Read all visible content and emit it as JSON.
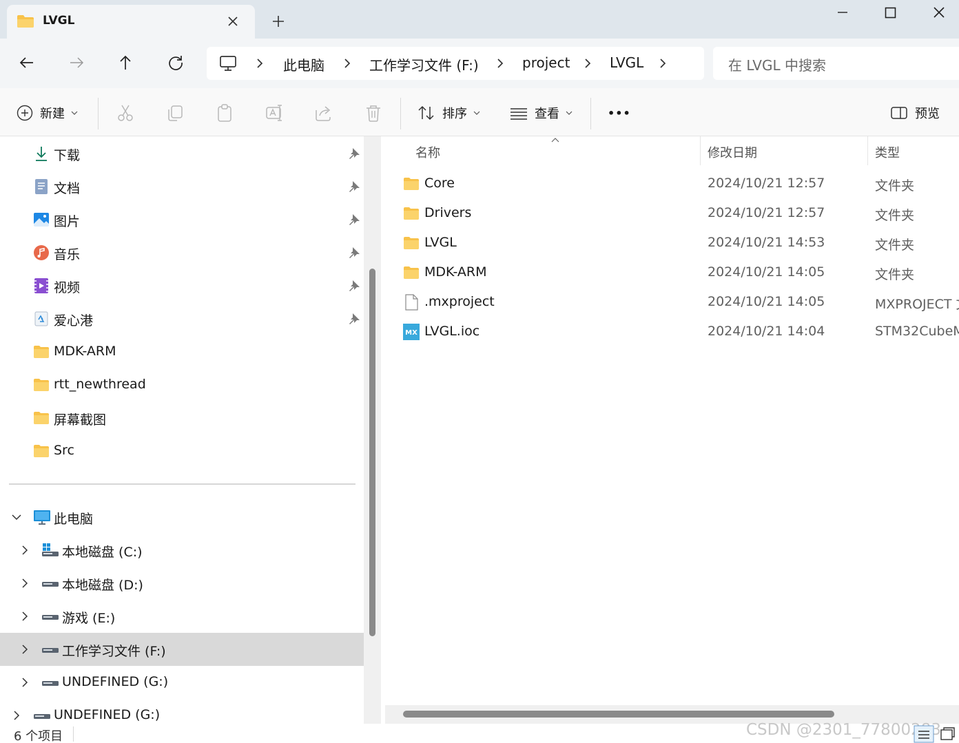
{
  "tab": {
    "title": "LVGL",
    "close_icon": "close-icon",
    "new_tab_icon": "plus-icon"
  },
  "window": {
    "minimize_icon": "minimize-icon",
    "maximize_icon": "maximize-icon",
    "close_icon": "close-icon"
  },
  "nav": {
    "back_icon": "arrow-left-icon",
    "forward_icon": "arrow-right-icon",
    "up_icon": "arrow-up-icon",
    "refresh_icon": "refresh-icon"
  },
  "breadcrumb": [
    "此电脑",
    "工作学习文件 (F:)",
    "project",
    "LVGL"
  ],
  "search": {
    "placeholder": "在 LVGL 中搜索"
  },
  "toolbar": {
    "new_label": "新建",
    "sort_label": "排序",
    "view_label": "查看",
    "more_label": "•••",
    "preview_label": "预览"
  },
  "quick_access": [
    {
      "label": "下载",
      "icon": "download-icon"
    },
    {
      "label": "文档",
      "icon": "document-icon"
    },
    {
      "label": "图片",
      "icon": "pictures-icon"
    },
    {
      "label": "音乐",
      "icon": "music-icon"
    },
    {
      "label": "视频",
      "icon": "video-icon"
    },
    {
      "label": "爱心港",
      "icon": "app-icon"
    },
    {
      "label": "MDK-ARM",
      "icon": "folder-icon"
    },
    {
      "label": "rtt_newthread",
      "icon": "folder-icon"
    },
    {
      "label": "屏幕截图",
      "icon": "folder-icon"
    },
    {
      "label": "Src",
      "icon": "folder-icon"
    }
  ],
  "tree": [
    {
      "label": "此电脑",
      "icon": "computer-icon"
    },
    {
      "label": "本地磁盘 (C:)",
      "icon": "system-drive-icon"
    },
    {
      "label": "本地磁盘 (D:)",
      "icon": "drive-icon"
    },
    {
      "label": "游戏 (E:)",
      "icon": "drive-icon"
    },
    {
      "label": "工作学习文件 (F:)",
      "icon": "drive-icon"
    },
    {
      "label": "UNDEFINED (G:)",
      "icon": "drive-icon"
    },
    {
      "label": "UNDEFINED (G:)",
      "icon": "drive-icon"
    }
  ],
  "columns": {
    "name": "名称",
    "date": "修改日期",
    "type": "类型"
  },
  "files": [
    {
      "name": "Core",
      "date": "2024/10/21 12:57",
      "type": "文件夹",
      "icon": "folder-icon"
    },
    {
      "name": "Drivers",
      "date": "2024/10/21 12:57",
      "type": "文件夹",
      "icon": "folder-icon"
    },
    {
      "name": "LVGL",
      "date": "2024/10/21 14:53",
      "type": "文件夹",
      "icon": "folder-icon"
    },
    {
      "name": "MDK-ARM",
      "date": "2024/10/21 14:05",
      "type": "文件夹",
      "icon": "folder-icon"
    },
    {
      "name": ".mxproject",
      "date": "2024/10/21 14:05",
      "type": "MXPROJECT 文",
      "icon": "file-icon"
    },
    {
      "name": "LVGL.ioc",
      "date": "2024/10/21 14:04",
      "type": "STM32CubeM",
      "icon": "stm32cubemx-icon",
      "icon_text": "MX"
    }
  ],
  "status": {
    "count": "6 个项目",
    "watermark": "CSDN @2301_77800283"
  },
  "colors": {
    "accent": "#0067c0",
    "folder": "#f8c24a",
    "selected": "#d9d9d9"
  }
}
